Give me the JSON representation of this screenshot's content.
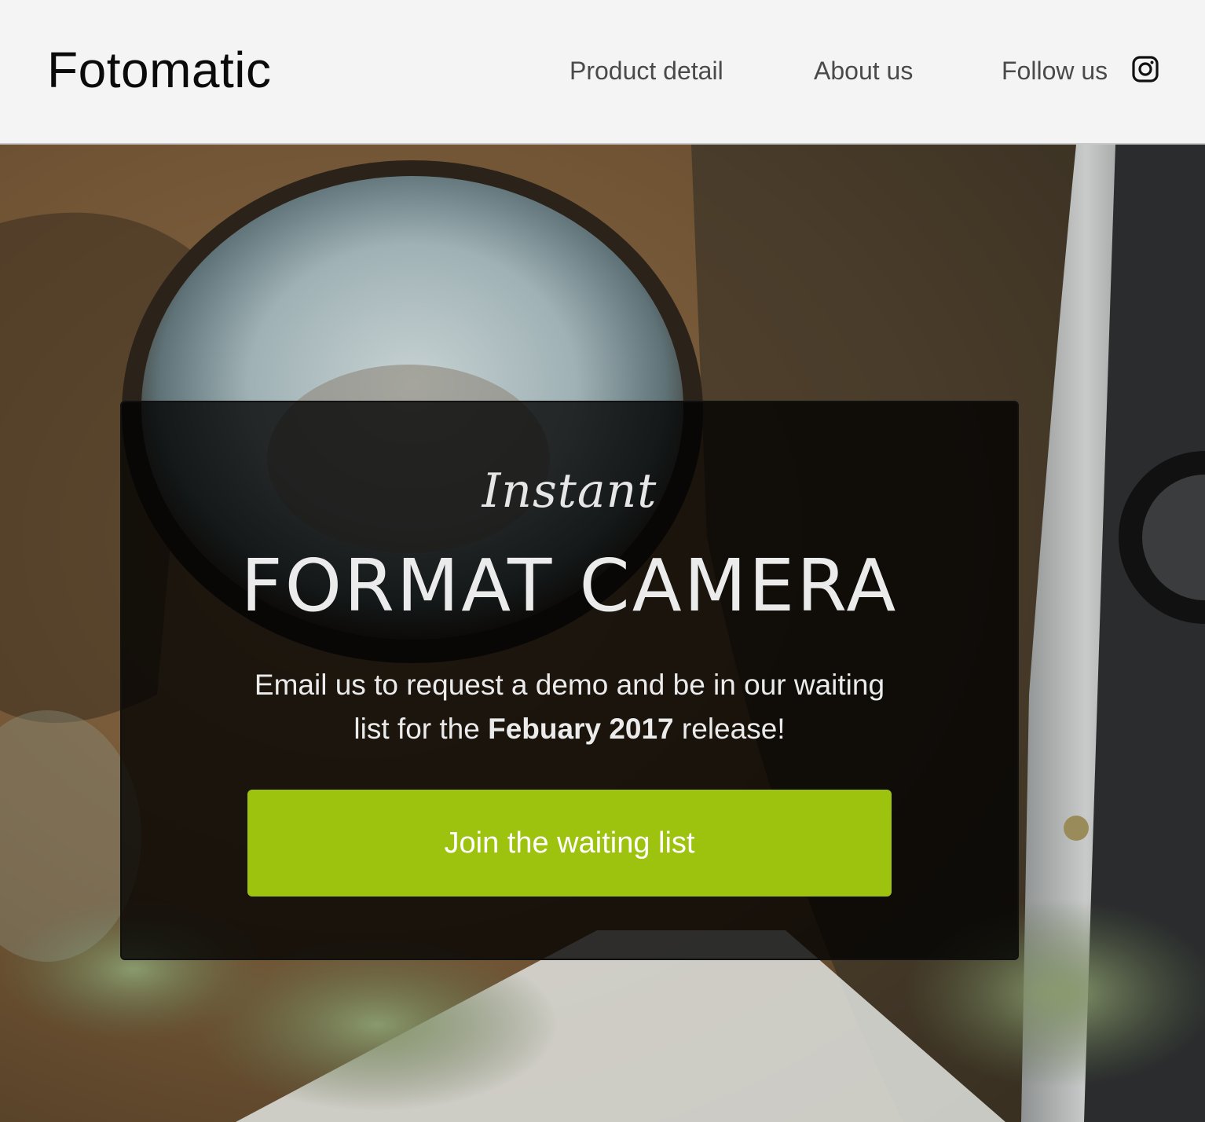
{
  "header": {
    "logo": "Fotomatic",
    "nav": {
      "product": "Product detail",
      "about": "About us",
      "follow": "Follow us"
    },
    "social_icon": "instagram-icon"
  },
  "hero": {
    "script_title": "Instant",
    "headline": "FORMAT CAMERA",
    "description_pre": "Email us to request a demo and be in our waiting list for the ",
    "description_bold": "Febuary 2017",
    "description_post": " release!",
    "cta_label": "Join the waiting list"
  },
  "colors": {
    "accent": "#9dc30e",
    "header_bg": "#f4f4f4",
    "overlay": "#000000"
  }
}
